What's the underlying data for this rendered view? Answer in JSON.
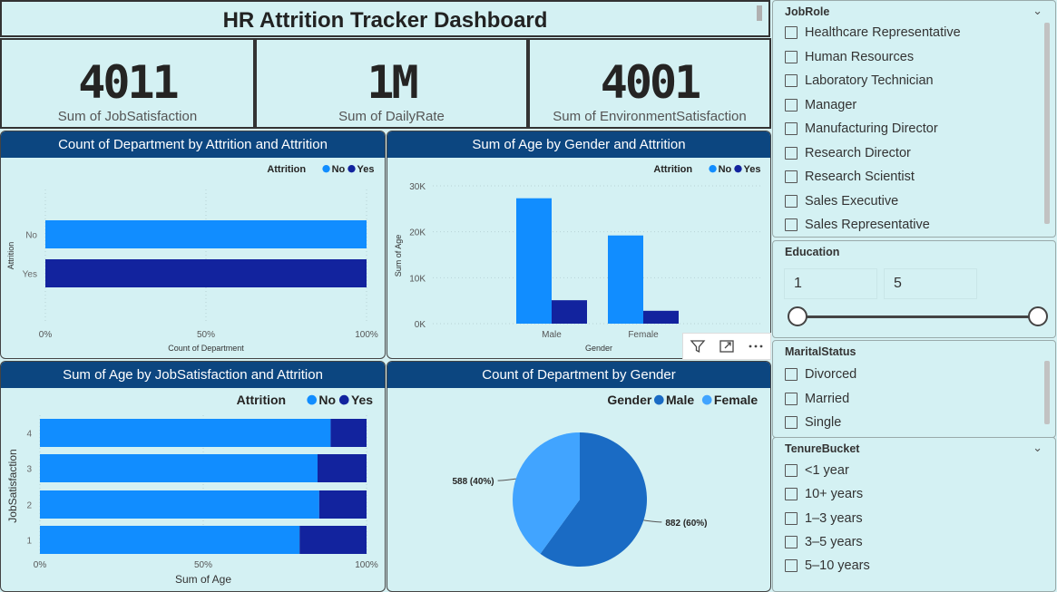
{
  "header": {
    "title": "HR Attrition Tracker Dashboard"
  },
  "kpis": [
    {
      "value": "4011",
      "label": "Sum of JobSatisfaction"
    },
    {
      "value": "1M",
      "label": "Sum of DailyRate"
    },
    {
      "value": "4001",
      "label": "Sum of EnvironmentSatisfaction"
    }
  ],
  "colors": {
    "no": "#118dff",
    "yes": "#12239e",
    "male": "#1a6bc4",
    "female": "#41a4ff",
    "header": "#0c4680"
  },
  "chart_data": [
    {
      "type": "bar",
      "title": "Count of Department by Attrition and Attrition",
      "orientation": "horizontal-100%-stacked",
      "categories": [
        "No",
        "Yes"
      ],
      "series": [
        {
          "name": "No",
          "values": [
            100,
            0
          ]
        },
        {
          "name": "Yes",
          "values": [
            0,
            100
          ]
        }
      ],
      "xlabel": "Count of Department",
      "ylabel": "Attrition",
      "xticks": [
        "0%",
        "50%",
        "100%"
      ],
      "legend_title": "Attrition",
      "legend_position": "top-right"
    },
    {
      "type": "bar",
      "title": "Sum of Age by Gender and Attrition",
      "orientation": "vertical-clustered",
      "categories": [
        "Male",
        "Female"
      ],
      "series": [
        {
          "name": "No",
          "values": [
            27300,
            19200
          ]
        },
        {
          "name": "Yes",
          "values": [
            5100,
            2800
          ]
        }
      ],
      "xlabel": "Gender",
      "ylabel": "Sum of Age",
      "yticks": [
        "0K",
        "10K",
        "20K",
        "30K"
      ],
      "ylim": [
        0,
        30000
      ],
      "legend_title": "Attrition",
      "legend_position": "top-right"
    },
    {
      "type": "bar",
      "title": "Sum of Age by JobSatisfaction and Attrition",
      "orientation": "horizontal-100%-stacked",
      "categories": [
        "4",
        "3",
        "2",
        "1"
      ],
      "series": [
        {
          "name": "No",
          "values": [
            89,
            85,
            85.5,
            79.5
          ]
        },
        {
          "name": "Yes",
          "values": [
            11,
            15,
            14.5,
            20.5
          ]
        }
      ],
      "xlabel": "Sum of Age",
      "ylabel": "JobSatisfaction",
      "xticks": [
        "0%",
        "50%",
        "100%"
      ],
      "legend_title": "Attrition",
      "legend_position": "top-right"
    },
    {
      "type": "pie",
      "title": "Count of Department by Gender",
      "slices": [
        {
          "name": "Male",
          "value": 882,
          "label": "882 (60%)"
        },
        {
          "name": "Female",
          "value": 588,
          "label": "588 (40%)"
        }
      ],
      "legend_title": "Gender",
      "legend_position": "top-right"
    }
  ],
  "slicers": {
    "jobrole": {
      "title": "JobRole",
      "items": [
        "Healthcare Representative",
        "Human Resources",
        "Laboratory Technician",
        "Manager",
        "Manufacturing Director",
        "Research Director",
        "Research Scientist",
        "Sales Executive",
        "Sales Representative"
      ]
    },
    "education": {
      "title": "Education",
      "min": "1",
      "max": "5"
    },
    "marital": {
      "title": "MaritalStatus",
      "items": [
        "Divorced",
        "Married",
        "Single"
      ]
    },
    "tenure": {
      "title": "TenureBucket",
      "items": [
        "<1 year",
        "10+ years",
        "1–3 years",
        "3–5 years",
        "5–10 years"
      ]
    }
  },
  "tools": {
    "filter_icon": "filter-icon",
    "focus_icon": "focus-mode-icon",
    "more_icon": "more-options-icon"
  }
}
